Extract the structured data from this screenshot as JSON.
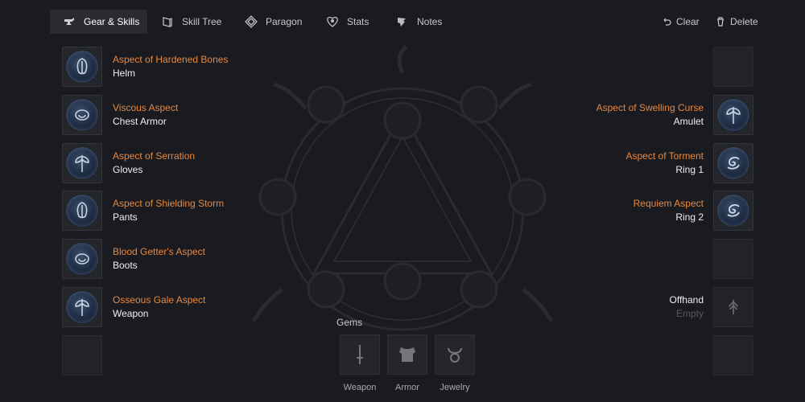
{
  "tabs": [
    {
      "label": "Gear & Skills",
      "icon": "anvil-icon",
      "active": true
    },
    {
      "label": "Skill Tree",
      "icon": "book-icon",
      "active": false
    },
    {
      "label": "Paragon",
      "icon": "paragon-diamond-icon",
      "active": false
    },
    {
      "label": "Stats",
      "icon": "heart-shield-icon",
      "active": false
    },
    {
      "label": "Notes",
      "icon": "quill-icon",
      "active": false
    }
  ],
  "toolbar": {
    "clear_label": "Clear",
    "delete_label": "Delete"
  },
  "left_slots": [
    {
      "aspect": "Aspect of Hardened Bones",
      "slot": "Helm",
      "icon": "bone-shield-icon"
    },
    {
      "aspect": "Viscous Aspect",
      "slot": "Chest Armor",
      "icon": "swirl-icon"
    },
    {
      "aspect": "Aspect of Serration",
      "slot": "Gloves",
      "icon": "axe-icon"
    },
    {
      "aspect": "Aspect of Shielding Storm",
      "slot": "Pants",
      "icon": "bone-shield-icon"
    },
    {
      "aspect": "Blood Getter's Aspect",
      "slot": "Boots",
      "icon": "swirl-icon"
    },
    {
      "aspect": "Osseous Gale Aspect",
      "slot": "Weapon",
      "icon": "axe-icon"
    }
  ],
  "right_slots": [
    {
      "aspect": "Aspect of Swelling Curse",
      "slot": "Amulet",
      "icon": "axe-icon"
    },
    {
      "aspect": "Aspect of Torment",
      "slot": "Ring 1",
      "icon": "spiral-icon"
    },
    {
      "aspect": "Requiem Aspect",
      "slot": "Ring 2",
      "icon": "spiral-icon"
    }
  ],
  "offhand": {
    "label": "Offhand",
    "status": "Empty",
    "icon": "tree-rune-icon"
  },
  "gems": {
    "title": "Gems",
    "slots": [
      {
        "label": "Weapon",
        "icon": "dagger-icon"
      },
      {
        "label": "Armor",
        "icon": "chestplate-icon"
      },
      {
        "label": "Jewelry",
        "icon": "necklace-icon"
      }
    ]
  },
  "colors": {
    "aspect_text": "#e5883f",
    "background": "#1a1b20",
    "slot_bg": "#25262b"
  }
}
